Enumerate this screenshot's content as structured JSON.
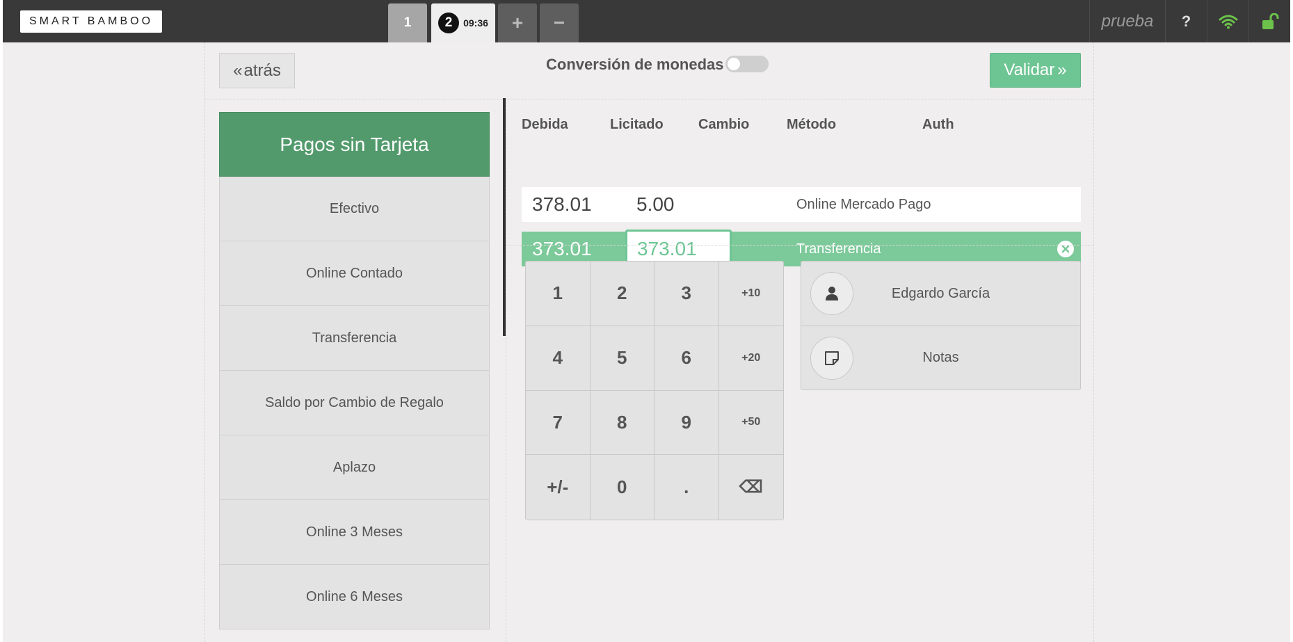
{
  "header": {
    "logo_text": "SMART BAMBOO",
    "orders": [
      {
        "label": "1"
      },
      {
        "number": "2",
        "time": "09:36"
      }
    ],
    "add_order_label": "+",
    "remove_order_label": "−",
    "username": "prueba",
    "help_label": "?",
    "icons": [
      "help-icon",
      "wifi-icon",
      "unlock-icon"
    ],
    "wifi_color": "#6cc24a",
    "lock_color": "#6cc24a"
  },
  "toolbar": {
    "back_label": "atrás",
    "back_icon": "«",
    "conversion_label": "Conversión de monedas",
    "conversion_enabled": false,
    "validate_label": "Validar",
    "validate_icon": "»"
  },
  "payment_methods": {
    "header": "Pagos sin Tarjeta",
    "items": [
      "Efectivo",
      "Online Contado",
      "Transferencia",
      "Saldo por Cambio de Regalo",
      "Aplazo",
      "Online 3 Meses",
      "Online 6 Meses"
    ]
  },
  "payment_lines": {
    "columns": [
      "Debida",
      "Licitado",
      "Cambio",
      "Método",
      "Auth"
    ],
    "rows": [
      {
        "due": "378.01",
        "tendered": "5.00",
        "change": "",
        "method": "Online Mercado Pago",
        "auth": ""
      },
      {
        "due": "373.01",
        "tendered": "373.01",
        "change": "",
        "method": "Transferencia",
        "auth": "",
        "selected": true
      }
    ]
  },
  "numpad": {
    "keys": [
      "1",
      "2",
      "3",
      "+10",
      "4",
      "5",
      "6",
      "+20",
      "7",
      "8",
      "9",
      "+50",
      "+/-",
      "0",
      ".",
      "⌫"
    ]
  },
  "side_actions": {
    "customer_label": "Edgardo García",
    "notes_label": "Notas"
  },
  "colors": {
    "accent_green": "#6ec594",
    "header_green": "#529a6c",
    "topbar": "#393939"
  }
}
